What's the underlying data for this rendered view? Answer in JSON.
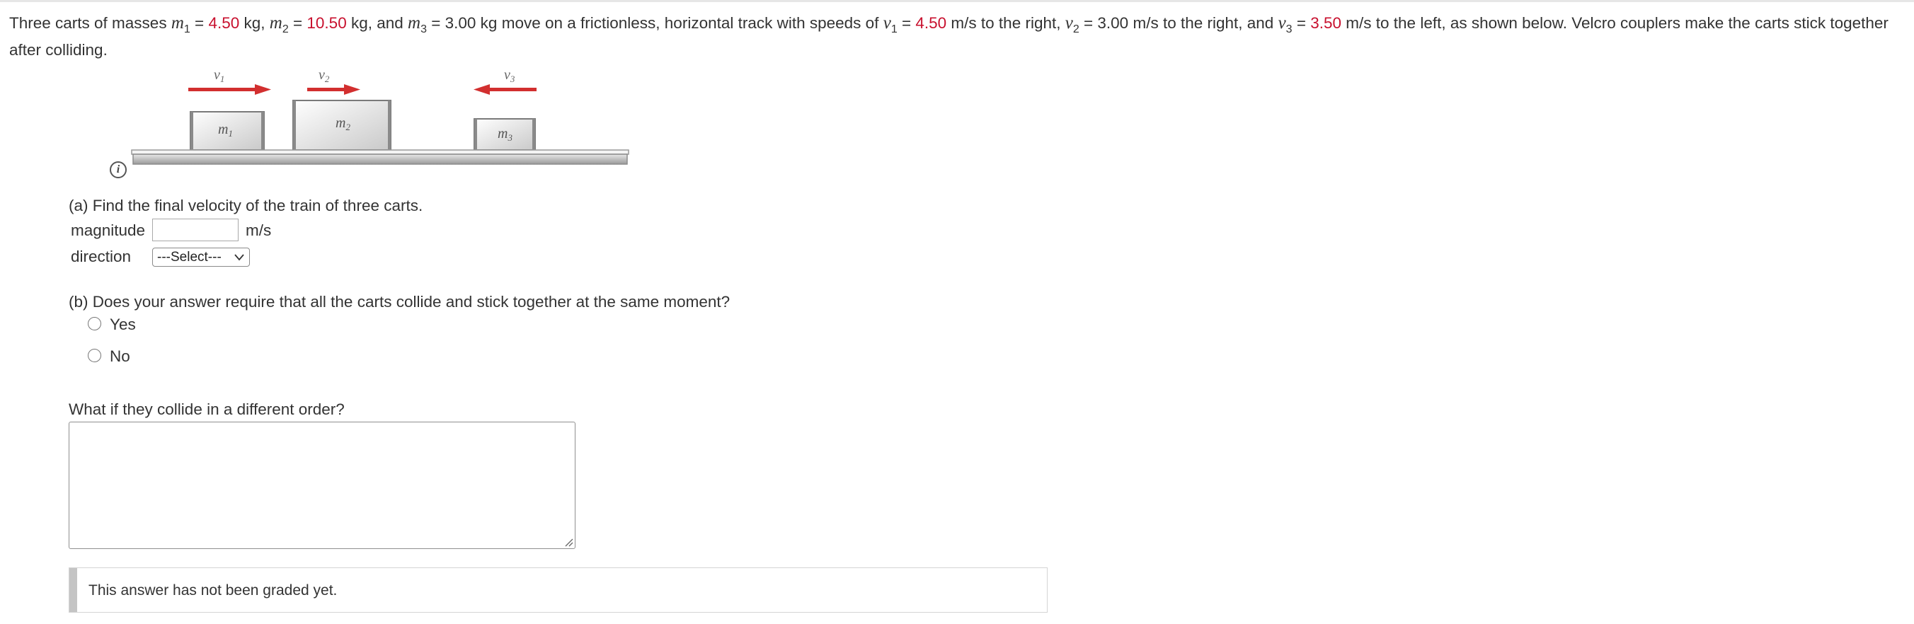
{
  "problem": {
    "p1": "Three carts of masses ",
    "m_sym": "m",
    "sub1": "1",
    "sub2": "2",
    "sub3": "3",
    "eq": " = ",
    "m1_val": "4.50",
    "kg_comma": " kg, ",
    "m2_val": "10.50",
    "kg_and": " kg, and ",
    "m3_rest": " = 3.00 kg move on a frictionless, horizontal track with speeds of ",
    "v_sym": "v",
    "v1_val": "4.50",
    "ms_right_comma": " m/s to the right, ",
    "v2_rest": " = 3.00 m/s to the right, and ",
    "v3_val": "3.50",
    "tail": " m/s to the left, as shown below. Velcro couplers make the carts stick together after colliding."
  },
  "figure": {
    "v1_label": "v1",
    "v2_label": "v2",
    "v3_label": "v3",
    "m1_label": "m1",
    "m2_label": "m2",
    "m3_label": "m3",
    "arrow_color": "#d22f2f"
  },
  "info_icon": "i",
  "part_a": {
    "question": "(a) Find the final velocity of the train of three carts.",
    "magnitude_label": "magnitude",
    "magnitude_value": "",
    "unit": "m/s",
    "direction_label": "direction",
    "direction_selected": "---Select---"
  },
  "part_b": {
    "question": "(b) Does your answer require that all the carts collide and stick together at the same moment?",
    "options": [
      "Yes",
      "No"
    ]
  },
  "what_if": {
    "question": "What if they collide in a different order?",
    "answer": ""
  },
  "status": {
    "text": "This answer has not been graded yet."
  },
  "colors": {
    "given_value": "#c8102e",
    "text": "#333333"
  }
}
